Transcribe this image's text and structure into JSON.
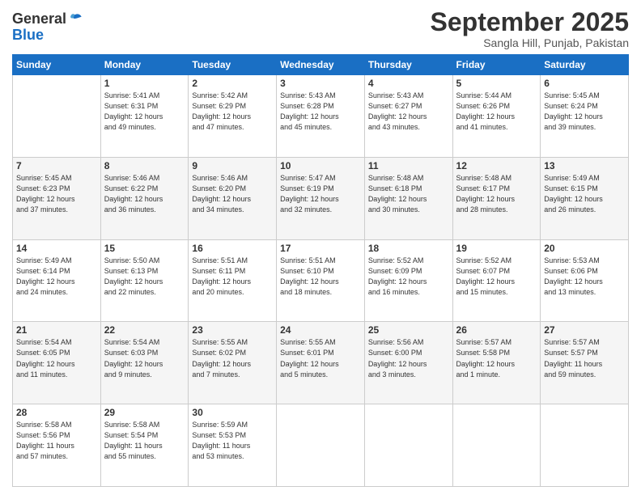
{
  "header": {
    "logo_general": "General",
    "logo_blue": "Blue",
    "month_title": "September 2025",
    "location": "Sangla Hill, Punjab, Pakistan"
  },
  "days_of_week": [
    "Sunday",
    "Monday",
    "Tuesday",
    "Wednesday",
    "Thursday",
    "Friday",
    "Saturday"
  ],
  "weeks": [
    [
      {
        "day": "",
        "info": ""
      },
      {
        "day": "1",
        "info": "Sunrise: 5:41 AM\nSunset: 6:31 PM\nDaylight: 12 hours\nand 49 minutes."
      },
      {
        "day": "2",
        "info": "Sunrise: 5:42 AM\nSunset: 6:29 PM\nDaylight: 12 hours\nand 47 minutes."
      },
      {
        "day": "3",
        "info": "Sunrise: 5:43 AM\nSunset: 6:28 PM\nDaylight: 12 hours\nand 45 minutes."
      },
      {
        "day": "4",
        "info": "Sunrise: 5:43 AM\nSunset: 6:27 PM\nDaylight: 12 hours\nand 43 minutes."
      },
      {
        "day": "5",
        "info": "Sunrise: 5:44 AM\nSunset: 6:26 PM\nDaylight: 12 hours\nand 41 minutes."
      },
      {
        "day": "6",
        "info": "Sunrise: 5:45 AM\nSunset: 6:24 PM\nDaylight: 12 hours\nand 39 minutes."
      }
    ],
    [
      {
        "day": "7",
        "info": "Sunrise: 5:45 AM\nSunset: 6:23 PM\nDaylight: 12 hours\nand 37 minutes."
      },
      {
        "day": "8",
        "info": "Sunrise: 5:46 AM\nSunset: 6:22 PM\nDaylight: 12 hours\nand 36 minutes."
      },
      {
        "day": "9",
        "info": "Sunrise: 5:46 AM\nSunset: 6:20 PM\nDaylight: 12 hours\nand 34 minutes."
      },
      {
        "day": "10",
        "info": "Sunrise: 5:47 AM\nSunset: 6:19 PM\nDaylight: 12 hours\nand 32 minutes."
      },
      {
        "day": "11",
        "info": "Sunrise: 5:48 AM\nSunset: 6:18 PM\nDaylight: 12 hours\nand 30 minutes."
      },
      {
        "day": "12",
        "info": "Sunrise: 5:48 AM\nSunset: 6:17 PM\nDaylight: 12 hours\nand 28 minutes."
      },
      {
        "day": "13",
        "info": "Sunrise: 5:49 AM\nSunset: 6:15 PM\nDaylight: 12 hours\nand 26 minutes."
      }
    ],
    [
      {
        "day": "14",
        "info": "Sunrise: 5:49 AM\nSunset: 6:14 PM\nDaylight: 12 hours\nand 24 minutes."
      },
      {
        "day": "15",
        "info": "Sunrise: 5:50 AM\nSunset: 6:13 PM\nDaylight: 12 hours\nand 22 minutes."
      },
      {
        "day": "16",
        "info": "Sunrise: 5:51 AM\nSunset: 6:11 PM\nDaylight: 12 hours\nand 20 minutes."
      },
      {
        "day": "17",
        "info": "Sunrise: 5:51 AM\nSunset: 6:10 PM\nDaylight: 12 hours\nand 18 minutes."
      },
      {
        "day": "18",
        "info": "Sunrise: 5:52 AM\nSunset: 6:09 PM\nDaylight: 12 hours\nand 16 minutes."
      },
      {
        "day": "19",
        "info": "Sunrise: 5:52 AM\nSunset: 6:07 PM\nDaylight: 12 hours\nand 15 minutes."
      },
      {
        "day": "20",
        "info": "Sunrise: 5:53 AM\nSunset: 6:06 PM\nDaylight: 12 hours\nand 13 minutes."
      }
    ],
    [
      {
        "day": "21",
        "info": "Sunrise: 5:54 AM\nSunset: 6:05 PM\nDaylight: 12 hours\nand 11 minutes."
      },
      {
        "day": "22",
        "info": "Sunrise: 5:54 AM\nSunset: 6:03 PM\nDaylight: 12 hours\nand 9 minutes."
      },
      {
        "day": "23",
        "info": "Sunrise: 5:55 AM\nSunset: 6:02 PM\nDaylight: 12 hours\nand 7 minutes."
      },
      {
        "day": "24",
        "info": "Sunrise: 5:55 AM\nSunset: 6:01 PM\nDaylight: 12 hours\nand 5 minutes."
      },
      {
        "day": "25",
        "info": "Sunrise: 5:56 AM\nSunset: 6:00 PM\nDaylight: 12 hours\nand 3 minutes."
      },
      {
        "day": "26",
        "info": "Sunrise: 5:57 AM\nSunset: 5:58 PM\nDaylight: 12 hours\nand 1 minute."
      },
      {
        "day": "27",
        "info": "Sunrise: 5:57 AM\nSunset: 5:57 PM\nDaylight: 11 hours\nand 59 minutes."
      }
    ],
    [
      {
        "day": "28",
        "info": "Sunrise: 5:58 AM\nSunset: 5:56 PM\nDaylight: 11 hours\nand 57 minutes."
      },
      {
        "day": "29",
        "info": "Sunrise: 5:58 AM\nSunset: 5:54 PM\nDaylight: 11 hours\nand 55 minutes."
      },
      {
        "day": "30",
        "info": "Sunrise: 5:59 AM\nSunset: 5:53 PM\nDaylight: 11 hours\nand 53 minutes."
      },
      {
        "day": "",
        "info": ""
      },
      {
        "day": "",
        "info": ""
      },
      {
        "day": "",
        "info": ""
      },
      {
        "day": "",
        "info": ""
      }
    ]
  ]
}
